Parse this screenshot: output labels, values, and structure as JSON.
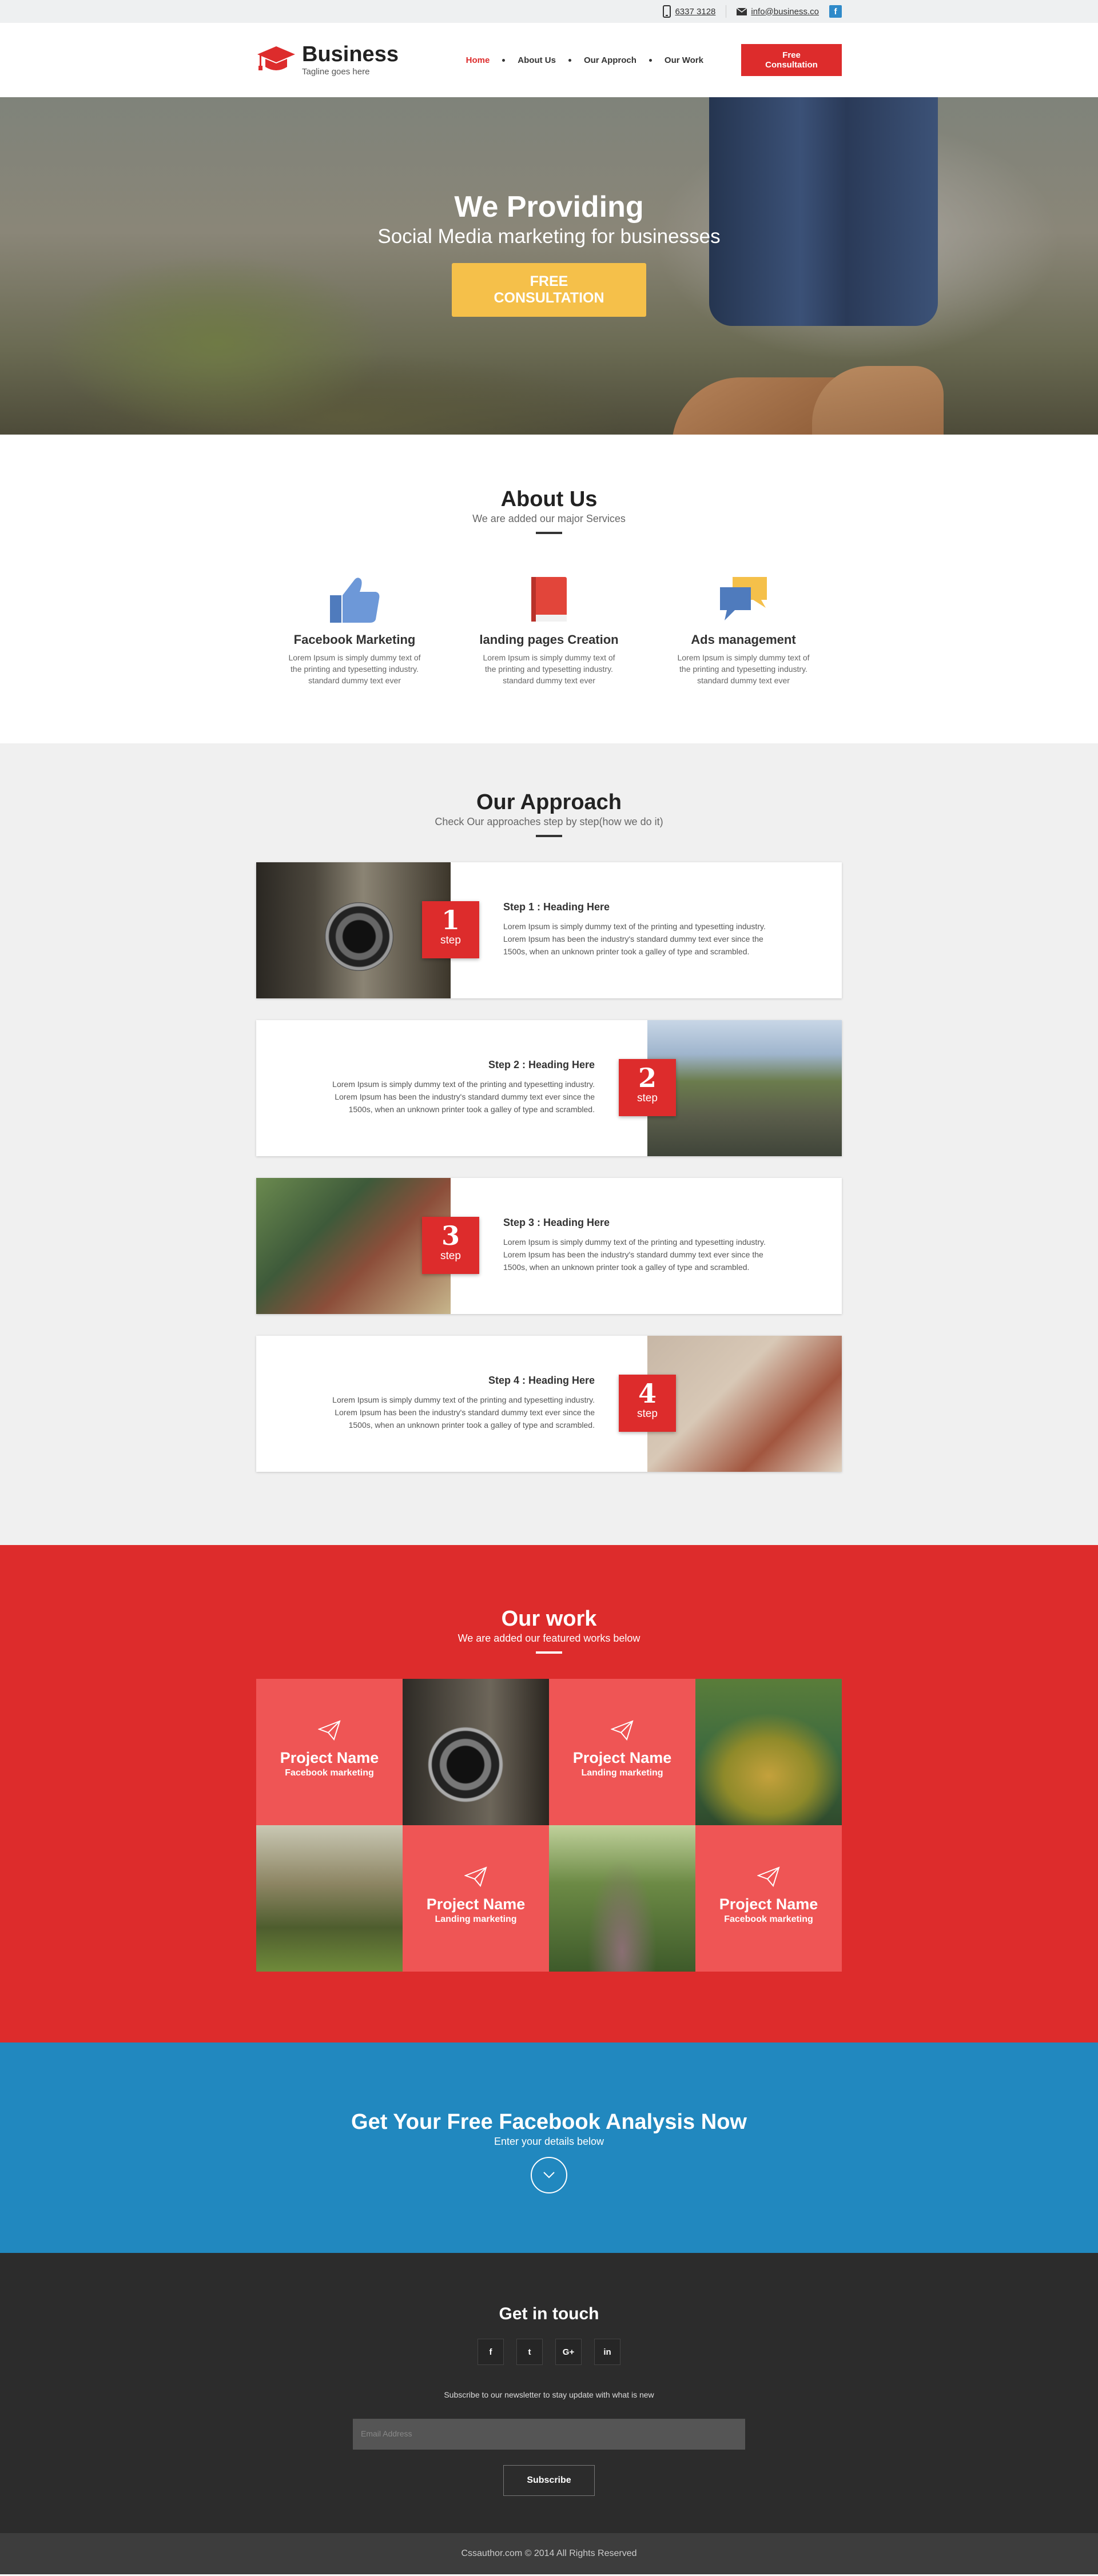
{
  "topbar": {
    "phone": "6337 3128",
    "email": "info@business.co",
    "social": "f"
  },
  "brand": {
    "name": "Business",
    "tagline": "Tagline goes here"
  },
  "nav": {
    "items": [
      "Home",
      "About Us",
      "Our Approch",
      "Our Work"
    ],
    "cta": "Free Consultation"
  },
  "hero": {
    "title": "We Providing",
    "subtitle": "Social Media marketing for businesses",
    "button": "FREE CONSULTATION"
  },
  "about": {
    "title": "About Us",
    "subtitle": "We are added our major Services",
    "services": [
      {
        "icon": "thumbs-up-icon",
        "title": "Facebook Marketing",
        "text": "Lorem Ipsum is simply dummy text of the printing and typesetting industry. standard dummy text ever"
      },
      {
        "icon": "book-icon",
        "title": "landing pages Creation",
        "text": "Lorem Ipsum is simply dummy text of the printing and typesetting industry. standard dummy text ever"
      },
      {
        "icon": "chat-bubbles-icon",
        "title": "Ads management",
        "text": "Lorem Ipsum is simply dummy text of the printing and typesetting industry. standard dummy text ever"
      }
    ]
  },
  "approach": {
    "title": "Our Approach",
    "subtitle": "Check Our approaches step by step(how we do it)",
    "steps": [
      {
        "num": "1",
        "label": "step",
        "heading": "Step 1 : Heading Here",
        "text": "Lorem Ipsum is simply dummy text of the printing and typesetting industry. Lorem Ipsum has been the industry's standard dummy text ever since the 1500s, when an unknown printer took a galley of type and scrambled."
      },
      {
        "num": "2",
        "label": "step",
        "heading": "Step 2 : Heading Here",
        "text": "Lorem Ipsum is simply dummy text of the printing and typesetting industry. Lorem Ipsum has been the industry's standard dummy text ever since the 1500s, when an unknown printer took a galley of type and scrambled."
      },
      {
        "num": "3",
        "label": "step",
        "heading": "Step 3 : Heading Here",
        "text": "Lorem Ipsum is simply dummy text of the printing and typesetting industry. Lorem Ipsum has been the industry's standard dummy text ever since the 1500s, when an unknown printer took a galley of type and scrambled."
      },
      {
        "num": "4",
        "label": "step",
        "heading": "Step 4 : Heading Here",
        "text": "Lorem Ipsum is simply dummy text of the printing and typesetting industry. Lorem Ipsum has been the industry's standard dummy text ever since the 1500s, when an unknown printer took a galley of type and scrambled."
      }
    ]
  },
  "work": {
    "title": "Our work",
    "subtitle": "We are added our featured works below",
    "projects": [
      {
        "name": "Project Name",
        "category": "Facebook marketing"
      },
      {
        "name": "Project Name",
        "category": "Landing marketing"
      },
      {
        "name": "Project Name",
        "category": "Landing marketing"
      },
      {
        "name": "Project Name",
        "category": "Facebook marketing"
      }
    ]
  },
  "cta": {
    "title": "Get Your Free Facebook Analysis Now",
    "subtitle": "Enter your details below"
  },
  "footer": {
    "title": "Get in touch",
    "socials": [
      "f",
      "t",
      "G+",
      "in"
    ],
    "newsletter": "Subscribe to our newsletter to stay update with what is new",
    "email_placeholder": "Email Address",
    "subscribe": "Subscribe",
    "copyright": "Cssauthor.com © 2014 All Rights Reserved"
  },
  "colors": {
    "red": "#dd2c2c",
    "yellow": "#f5c04a",
    "blue": "#2188bf",
    "dark": "#2c2c2c"
  }
}
